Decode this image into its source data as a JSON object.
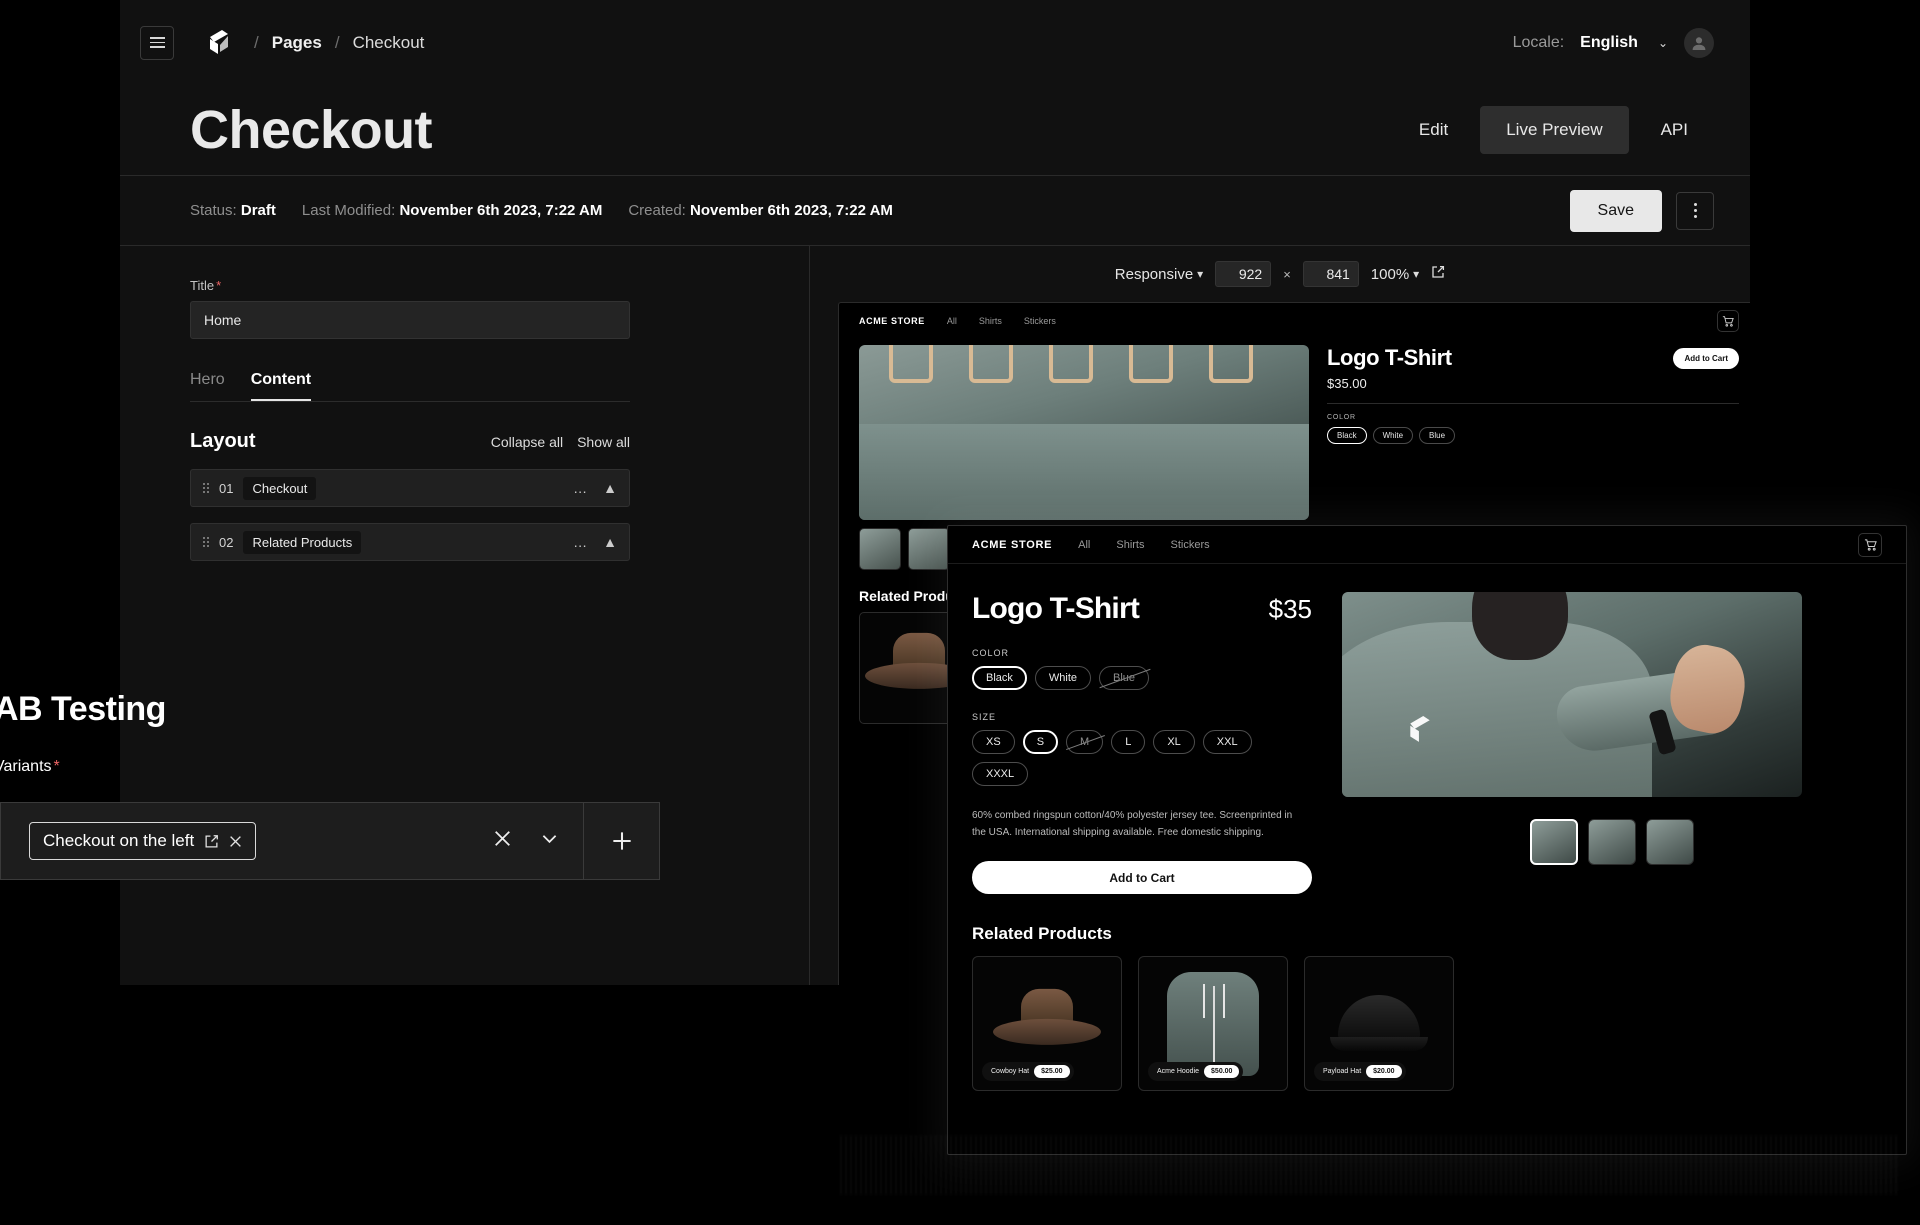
{
  "header": {
    "menu_icon": "hamburger-icon",
    "logo_icon": "payload-logo-icon",
    "breadcrumbs": [
      "Pages",
      "Checkout"
    ],
    "separator": "/",
    "locale_label": "Locale:",
    "locale_value": "English",
    "chevron": "⌄",
    "avatar_icon": "user-avatar-icon"
  },
  "page": {
    "title": "Checkout",
    "view_tabs": [
      {
        "label": "Edit",
        "active": false
      },
      {
        "label": "Live Preview",
        "active": true
      },
      {
        "label": "API",
        "active": false
      }
    ]
  },
  "status_bar": {
    "status_label": "Status:",
    "status_value": "Draft",
    "modified_label": "Last Modified:",
    "modified_value": "November 6th 2023, 7:22 AM",
    "created_label": "Created:",
    "created_value": "November 6th 2023, 7:22 AM",
    "save_label": "Save",
    "more_icon": "vertical-dots-icon"
  },
  "form": {
    "title_field": {
      "label": "Title",
      "required_mark": "*",
      "value": "Home",
      "placeholder": ""
    },
    "tabs": [
      {
        "label": "Hero",
        "active": false
      },
      {
        "label": "Content",
        "active": true
      }
    ],
    "layout": {
      "heading": "Layout",
      "collapse_all": "Collapse all",
      "show_all": "Show all",
      "blocks": [
        {
          "number": "01",
          "name": "Checkout"
        },
        {
          "number": "02",
          "name": "Related Products"
        }
      ]
    }
  },
  "preview_toolbar": {
    "breakpoint": "Responsive",
    "width": "922",
    "height": "841",
    "times": "×",
    "zoom": "100%",
    "external_icon": "external-link-icon"
  },
  "store_preview": {
    "brand": "ACME STORE",
    "nav": [
      "All",
      "Shirts",
      "Stickers"
    ],
    "cart_icon": "shopping-cart-icon",
    "product": {
      "title": "Logo T-Shirt",
      "price": "$35.00",
      "add_to_cart": "Add to Cart",
      "color_label": "COLOR",
      "colors": [
        "Black",
        "White",
        "Blue"
      ]
    },
    "related_heading": "Related Products"
  },
  "live_preview_window": {
    "brand": "ACME STORE",
    "nav": [
      "All",
      "Shirts",
      "Stickers"
    ],
    "cart_icon": "shopping-cart-icon",
    "product": {
      "title": "Logo T-Shirt",
      "price": "$35",
      "color_label": "COLOR",
      "colors": [
        {
          "label": "Black",
          "selected": true,
          "unavailable": false
        },
        {
          "label": "White",
          "selected": false,
          "unavailable": false
        },
        {
          "label": "Blue",
          "selected": false,
          "unavailable": true
        }
      ],
      "size_label": "SIZE",
      "sizes": [
        {
          "label": "XS",
          "selected": false,
          "unavailable": false
        },
        {
          "label": "S",
          "selected": true,
          "unavailable": false
        },
        {
          "label": "M",
          "selected": false,
          "unavailable": true
        },
        {
          "label": "L",
          "selected": false,
          "unavailable": false
        },
        {
          "label": "XL",
          "selected": false,
          "unavailable": false
        },
        {
          "label": "XXL",
          "selected": false,
          "unavailable": false
        },
        {
          "label": "XXXL",
          "selected": false,
          "unavailable": false
        }
      ],
      "description": "60% combed ringspun cotton/40% polyester jersey tee. Screenprinted in the USA. International shipping available. Free domestic shipping.",
      "add_to_cart": "Add to Cart"
    },
    "related_heading": "Related Products",
    "related_products": [
      {
        "name": "Cowboy Hat",
        "price": "$25.00",
        "art": "hat"
      },
      {
        "name": "Acme Hoodie",
        "price": "$50.00",
        "art": "hoodie"
      },
      {
        "name": "Payload Hat",
        "price": "$20.00",
        "art": "cap"
      }
    ]
  },
  "ab_testing": {
    "heading": "AB Testing",
    "variants_label": "Variants",
    "required_mark": "*",
    "variant_chip": {
      "label": "Checkout on the left",
      "edit_icon": "edit-external-icon",
      "remove_icon": "close-icon"
    },
    "close_icon": "close-icon",
    "collapse_icon": "chevron-down-icon",
    "add_icon": "plus-icon"
  },
  "colors": {
    "accent": "#ffffff",
    "required": "#ee6666",
    "panel": "#111111",
    "input": "#242424"
  }
}
